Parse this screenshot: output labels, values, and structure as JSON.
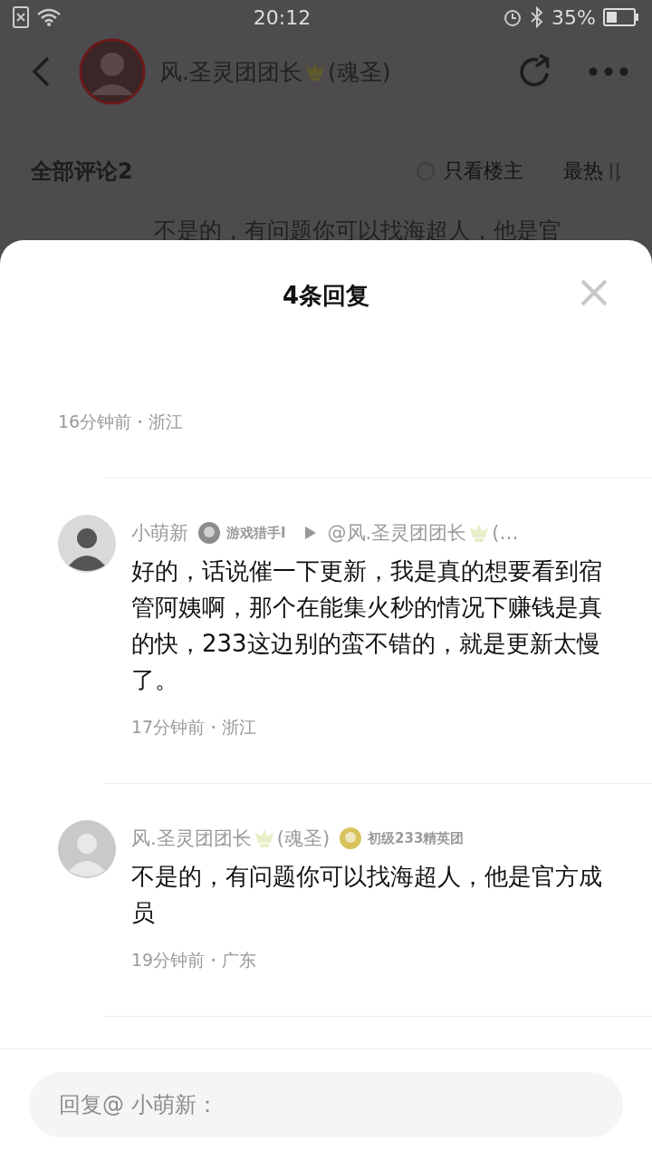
{
  "status_bar": {
    "time": "20:12",
    "battery": "35%"
  },
  "header": {
    "name": "风.圣灵团团长",
    "name_suffix": "(魂圣)"
  },
  "comments_bar": {
    "title": "全部评论2",
    "only_author": {
      "label": "只看楼主",
      "checked": false
    },
    "sort": "最热"
  },
  "background_comment": "不是的，有问题你可以找海超人，他是官",
  "sheet": {
    "title": "4条回复",
    "replies": [
      {
        "time": "16分钟前・浙江"
      },
      {
        "name": "小萌新",
        "badge": {
          "label": "游戏猎手I",
          "color": "#8c8c8c"
        },
        "reply_to": {
          "name": "@风.圣灵团团长",
          "suffix": "(…"
        },
        "text": "好的，话说催一下更新，我是真的想要看到宿管阿姨啊，那个在能集火秒的情况下赚钱是真的快，233这边别的蛮不错的，就是更新太慢了。",
        "time": "17分钟前・浙江"
      },
      {
        "name": "风.圣灵团团长",
        "name_suffix": "(魂圣)",
        "badge": {
          "label": "初级233精英团",
          "color": "#d8c25a"
        },
        "text": "不是的，有问题你可以找海超人，他是官方成员",
        "time": "19分钟前・广东"
      }
    ],
    "input": {
      "placeholder": "回复@ 小萌新："
    }
  }
}
